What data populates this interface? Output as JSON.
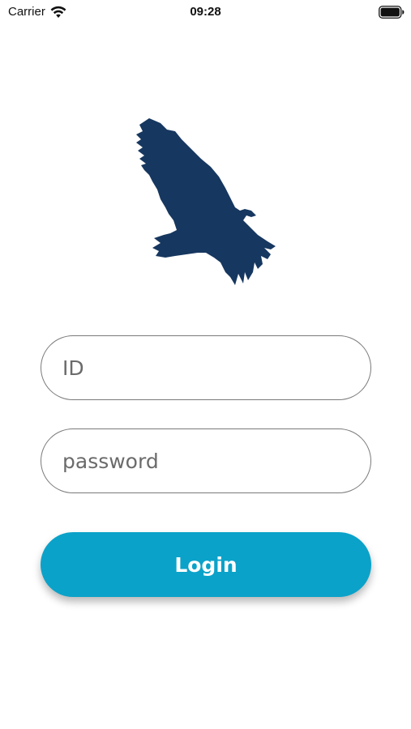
{
  "status_bar": {
    "carrier": "Carrier",
    "time": "09:28",
    "icons": {
      "wifi": "wifi-icon",
      "battery": "battery-icon"
    }
  },
  "logo": {
    "icon": "eagle-logo-icon",
    "color": "#16375f"
  },
  "form": {
    "id_field": {
      "placeholder": "ID",
      "value": ""
    },
    "password_field": {
      "placeholder": "password",
      "value": ""
    },
    "login_button": {
      "label": "Login",
      "color": "#0aa2c9"
    }
  }
}
